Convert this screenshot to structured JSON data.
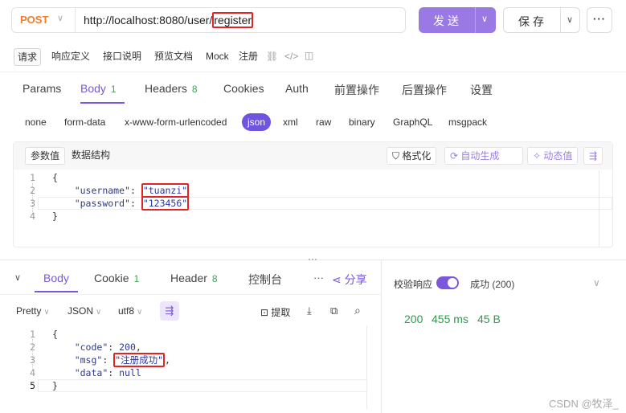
{
  "request": {
    "method": "POST",
    "url_prefix": "http://localhost:8080/user/",
    "url_highlight": "register",
    "send_label": "发送",
    "save_label": "保存"
  },
  "subtabs": [
    "请求",
    "响应定义",
    "接口说明",
    "预览文档",
    "Mock",
    "注册"
  ],
  "tabs": [
    {
      "label": "Params"
    },
    {
      "label": "Body",
      "count": "1"
    },
    {
      "label": "Headers",
      "count": "8"
    },
    {
      "label": "Cookies"
    },
    {
      "label": "Auth"
    },
    {
      "label": "前置操作"
    },
    {
      "label": "后置操作"
    },
    {
      "label": "设置"
    }
  ],
  "body_types": [
    "none",
    "form-data",
    "x-www-form-urlencoded",
    "json",
    "xml",
    "raw",
    "binary",
    "GraphQL",
    "msgpack"
  ],
  "editor": {
    "segments": [
      "参数值",
      "数据结构"
    ],
    "format_label": "格式化",
    "auto_label": "自动生成",
    "dynamic_label": "动态值",
    "lines": [
      "1",
      "2",
      "3",
      "4"
    ],
    "open": "{",
    "close": "}",
    "key_username": "\"username\"",
    "val_username": "\"tuanzi\"",
    "key_password": "\"password\"",
    "val_password": "\"123456\""
  },
  "response": {
    "tabs": [
      {
        "label": "Body"
      },
      {
        "label": "Cookie",
        "count": "1"
      },
      {
        "label": "Header",
        "count": "8"
      },
      {
        "label": "控制台"
      }
    ],
    "share_label": "分享",
    "pretty": "Pretty",
    "format": "JSON",
    "encoding": "utf8",
    "extract_label": "提取",
    "lines": [
      "1",
      "2",
      "3",
      "4",
      "5"
    ],
    "open": "{",
    "close": "}",
    "key_code": "\"code\"",
    "val_code": "200",
    "key_msg": "\"msg\"",
    "val_msg": "\"注册成功\"",
    "key_data": "\"data\"",
    "val_data": "null",
    "validate_label": "校验响应",
    "status_label": "成功 (200)",
    "status_code": "200",
    "time": "455 ms",
    "size": "45 B"
  },
  "watermark": "CSDN @牧泽_",
  "colors": {
    "accent": "#7b57d9",
    "method": "#f07c2e",
    "success": "#2f9a4f",
    "highlight": "#e02424"
  }
}
